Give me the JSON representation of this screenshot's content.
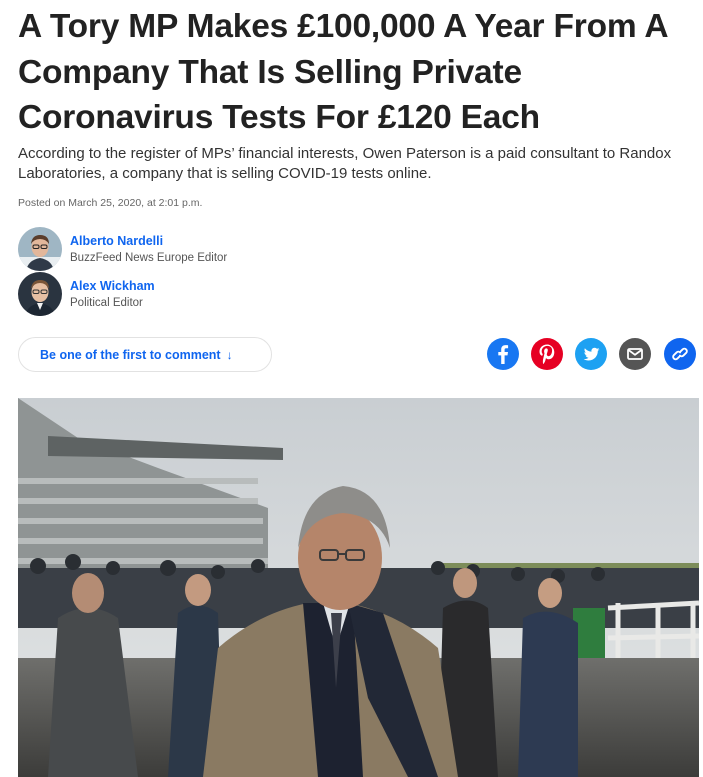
{
  "article": {
    "headline": "A Tory MP Makes £100,000 A Year From A Company That Is Selling Private Coronavirus Tests For £120 Each",
    "dek": "According to the register of MPs’ financial interests, Owen Paterson is a paid consultant to Randox Laboratories, a company that is selling COVID-19 tests online.",
    "posted": "Posted on March 25, 2020, at 2:01 p.m."
  },
  "bylines": [
    {
      "name": "Alberto Nardelli",
      "title": "BuzzFeed News Europe Editor"
    },
    {
      "name": "Alex Wickham",
      "title": "Political Editor"
    }
  ],
  "comment": {
    "label": "Be one of the first to comment",
    "arrow": "↓"
  },
  "share": {
    "icons": [
      "facebook-icon",
      "pinterest-icon",
      "twitter-icon",
      "email-icon",
      "link-icon"
    ],
    "colors": {
      "facebook": "#1877f2",
      "pinterest": "#e60023",
      "twitter": "#1da1f2",
      "email": "#555555",
      "link": "#0f65ef"
    }
  },
  "colors": {
    "link": "#0f65ef",
    "headline": "#222222"
  }
}
